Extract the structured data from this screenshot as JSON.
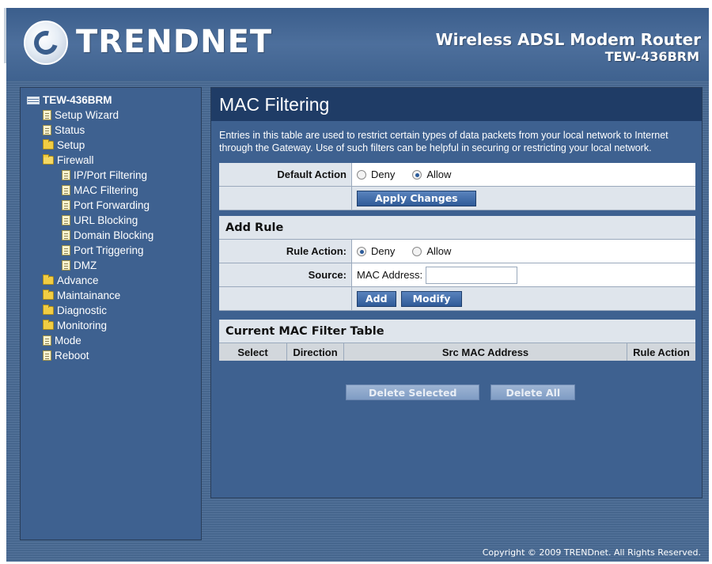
{
  "header": {
    "brand": "TRENDNET",
    "product_title": "Wireless ADSL Modem Router",
    "product_model": "TEW-436BRM"
  },
  "sidebar": {
    "root": "TEW-436BRM",
    "items": [
      {
        "label": "Setup Wizard",
        "icon": "document-icon",
        "level": 1
      },
      {
        "label": "Status",
        "icon": "document-icon",
        "level": 1
      },
      {
        "label": "Setup",
        "icon": "folder-icon",
        "level": 1
      },
      {
        "label": "Firewall",
        "icon": "folder-open-icon",
        "level": 1
      },
      {
        "label": "IP/Port Filtering",
        "icon": "document-icon",
        "level": 2
      },
      {
        "label": "MAC Filtering",
        "icon": "document-icon",
        "level": 2,
        "active": true
      },
      {
        "label": "Port Forwarding",
        "icon": "document-icon",
        "level": 2
      },
      {
        "label": "URL Blocking",
        "icon": "document-icon",
        "level": 2
      },
      {
        "label": "Domain Blocking",
        "icon": "document-icon",
        "level": 2
      },
      {
        "label": "Port Triggering",
        "icon": "document-icon",
        "level": 2
      },
      {
        "label": "DMZ",
        "icon": "document-icon",
        "level": 2
      },
      {
        "label": "Advance",
        "icon": "folder-icon",
        "level": 1
      },
      {
        "label": "Maintainance",
        "icon": "folder-icon",
        "level": 1
      },
      {
        "label": "Diagnostic",
        "icon": "folder-icon",
        "level": 1
      },
      {
        "label": "Monitoring",
        "icon": "folder-icon",
        "level": 1
      },
      {
        "label": "Mode",
        "icon": "document-icon",
        "level": 1
      },
      {
        "label": "Reboot",
        "icon": "document-icon",
        "level": 1
      }
    ]
  },
  "main": {
    "title": "MAC Filtering",
    "description": "Entries in this table are used to restrict certain types of data packets from your local network to Internet through the Gateway. Use of such filters can be helpful in securing or restricting your local network.",
    "default_action": {
      "label": "Default Action",
      "options": [
        "Deny",
        "Allow"
      ],
      "selected": "Allow",
      "apply_button": "Apply Changes"
    },
    "add_rule": {
      "heading": "Add Rule",
      "rule_action_label": "Rule Action:",
      "rule_options": [
        "Deny",
        "Allow"
      ],
      "rule_selected": "Deny",
      "source_label": "Source:",
      "mac_label": "MAC Address:",
      "mac_value": "",
      "add_button": "Add",
      "modify_button": "Modify"
    },
    "filter_table": {
      "heading": "Current MAC Filter Table",
      "columns": [
        "Select",
        "Direction",
        "Src MAC Address",
        "Rule Action"
      ],
      "rows": []
    },
    "delete_selected_button": "Delete Selected",
    "delete_all_button": "Delete All"
  },
  "footer": {
    "copyright": "Copyright © 2009 TRENDnet. All Rights Reserved."
  },
  "colors": {
    "frame_blue": "#4a6b95",
    "title_bar": "#1f3c66",
    "button": "#2f5b98"
  }
}
